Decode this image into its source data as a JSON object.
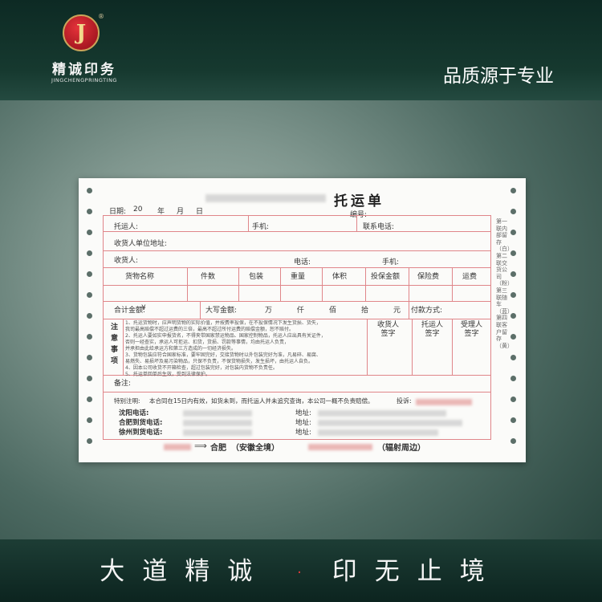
{
  "header": {
    "logo_glyph": "J",
    "logo_mark": "®",
    "brand_cn": "精诚印务",
    "brand_en": "JINGCHENGPRINGTING",
    "slogan": "品质源于专业"
  },
  "footer": {
    "motto_1": "大道精诚",
    "dot": "·",
    "motto_2": "印无止境"
  },
  "form": {
    "title": "托运单",
    "date_label": "日期:",
    "year_prefix": "20",
    "year": "年",
    "month": "月",
    "day": "日",
    "number_label": "编号:",
    "shipper_label": "托运人:",
    "mobile_label": "手机:",
    "contact_phone_label": "联系电话:",
    "receiver_company_label": "收货人单位地址:",
    "receiver_label": "收货人:",
    "phone_label": "电话:",
    "receiver_mobile_label": "手机:",
    "columns": [
      "货物名称",
      "件数",
      "包装",
      "重量",
      "体积",
      "投保金额",
      "保险费",
      "运费"
    ],
    "total_label": "合计金额:",
    "currency": "¥",
    "capital_amount_label": "大写金额:",
    "units": [
      "万",
      "仟",
      "佰",
      "拾",
      "元"
    ],
    "payment_label": "付款方式:",
    "notice_chars": [
      "注",
      "意",
      "事",
      "项"
    ],
    "notice_lines": [
      "1、托运货物时，应声明货物的实际价值，并按费率投保，在不投保情况下发生货损、货失，",
      "   我司最高赔偿不超过运费的三倍，最高不超过所付运费的赔偿金额，恕不赔付。",
      "2、托运人要如实申报货名，不得夹带国家禁运物品、国家控制物品，托运人应出具有关证件，",
      "   否则一经查实，承运人可拒运、扣货，货损、罚款等事情，均由托运人负责，",
      "   并承担由此给承运方和第三方造成的一切经济损失。",
      "3、货物包装应符合国家标准，要牢固完好，交接货物时以外包装完好为准，凡易碎、易腐、",
      "   易燃失、易损坏及易污染物品，只保不负责，不保货物损失，发生损坏，由托运人自负。",
      "4、因本公司收货不开箱检查，超过包装完好，对包装内货物不负责任。",
      "5、托运单回单后生效，受到法律保护。"
    ],
    "sign_receiver": [
      "收货人",
      "签字"
    ],
    "sign_shipper": [
      "托运人",
      "签字"
    ],
    "sign_handler": [
      "受理人",
      "签字"
    ],
    "remark_label": "备注:",
    "special_label": "特别注明:",
    "special_text": "本合同在15日内有效，如货未到，而托运人并未追究查询，本公司一概不负责赔偿。",
    "complaint_label": "投诉:",
    "route_1": "沈阳电话:",
    "route_2": "合肥到货电话:",
    "route_3": "徐州到货电话:",
    "address_label": "地址:",
    "destination_city": "合肥",
    "destination_scope": "（安徽全境）",
    "radiate_label": "（辐射周边）",
    "side_text": "第一联内部留存（白）第二联交货公司（粉）第三联随车（蓝）第四联客户留存（黄）"
  }
}
